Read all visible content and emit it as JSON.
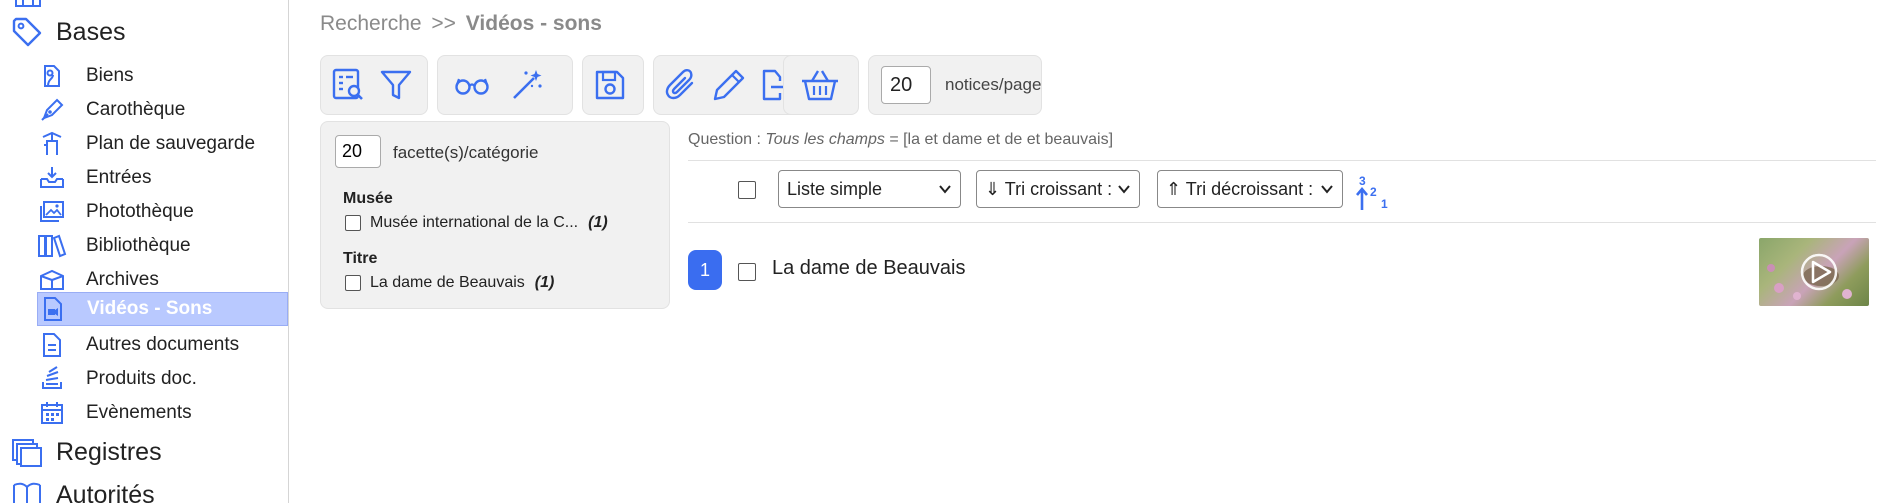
{
  "sidebar": {
    "groups": {
      "bases": "Bases",
      "registres": "Registres",
      "autorites": "Autorités"
    },
    "items": [
      {
        "label": "Biens",
        "icon": "object-tag-icon"
      },
      {
        "label": "Carothèque",
        "icon": "pen-nib-icon"
      },
      {
        "label": "Plan de sauvegarde",
        "icon": "fire-hydrant-icon"
      },
      {
        "label": "Entrées",
        "icon": "inbox-download-icon"
      },
      {
        "label": "Photothèque",
        "icon": "photos-icon"
      },
      {
        "label": "Bibliothèque",
        "icon": "books-icon"
      },
      {
        "label": "Archives",
        "icon": "archive-box-icon"
      },
      {
        "label": "Vidéos - Sons",
        "icon": "video-file-icon"
      },
      {
        "label": "Autres documents",
        "icon": "document-icon"
      },
      {
        "label": "Produits doc.",
        "icon": "stack-icon"
      },
      {
        "label": "Evènements",
        "icon": "calendar-icon"
      }
    ],
    "active_index": 7
  },
  "breadcrumb": {
    "root": "Recherche",
    "separator": ">>",
    "current": "Vidéos - sons"
  },
  "toolbar": {
    "notices_per_page_value": "20",
    "notices_per_page_label": "notices/page",
    "icons": [
      "search-list-icon",
      "filter-icon",
      "glasses-icon",
      "magic-wand-icon",
      "save-icon",
      "paperclip-icon",
      "pencil-icon",
      "export-icon",
      "basket-icon"
    ]
  },
  "facets": {
    "per_category_value": "20",
    "per_category_label": "facette(s)/catégorie",
    "categories": [
      {
        "name": "Musée",
        "values": [
          {
            "label": "Musée international de la C...",
            "count": "(1)"
          }
        ]
      },
      {
        "name": "Titre",
        "values": [
          {
            "label": "La dame de Beauvais",
            "count": "(1)"
          }
        ]
      }
    ]
  },
  "results": {
    "question_prefix": "Question :",
    "question_field": "Tous les champs",
    "question_query": "= [la et dame et de et beauvais]",
    "display_mode": "Liste simple",
    "sort_asc": "⇓ Tri croissant :",
    "sort_desc": "⇑ Tri décroissant :",
    "items": [
      {
        "number": "1",
        "title": "La dame de Beauvais"
      }
    ]
  },
  "colors": {
    "accent": "#3a6df0",
    "icon_blue": "#3b6ff0",
    "active_bg": "#b9c9ff"
  }
}
